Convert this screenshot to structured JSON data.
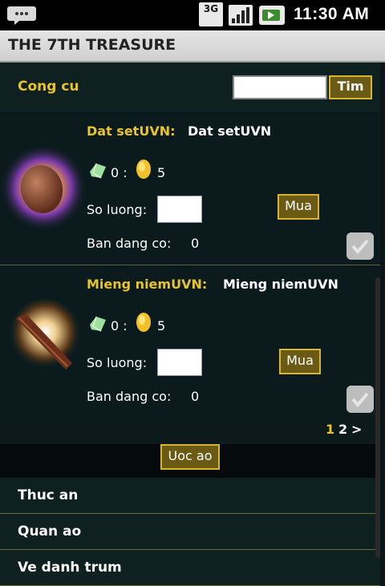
{
  "status_bar": {
    "network": "3G",
    "time": "11:30 AM",
    "icons": [
      "notification-icon",
      "signal-icon",
      "battery-icon"
    ]
  },
  "app": {
    "title": "THE 7TH TREASURE"
  },
  "category": {
    "name": "Cong cu",
    "search_value": "",
    "search_button": "Tim"
  },
  "items": [
    {
      "name_label": "Dat setUVN:",
      "name_value": "Dat setUVN",
      "gem_price": "0 :",
      "coin_price": "5",
      "qty_label": "So luong:",
      "qty_value": "",
      "buy_label": "Mua",
      "owned_label": "Ban dang co:",
      "owned_value": "0"
    },
    {
      "name_label": "Mieng niemUVN:",
      "name_value": "Mieng niemUVN",
      "gem_price": "0 :",
      "coin_price": "5",
      "qty_label": "So luong:",
      "qty_value": "",
      "buy_label": "Mua",
      "owned_label": "Ban dang co:",
      "owned_value": "0"
    }
  ],
  "pager": {
    "page1": "1",
    "page2": "2",
    "next": ">"
  },
  "wish_button": "Uoc ao",
  "categories": [
    "Thuc an",
    "Quan ao",
    "Ve danh trum"
  ],
  "colors": {
    "accent": "#e7c42e",
    "button_bg": "#6b5a14",
    "background": "#0d1a1c"
  }
}
